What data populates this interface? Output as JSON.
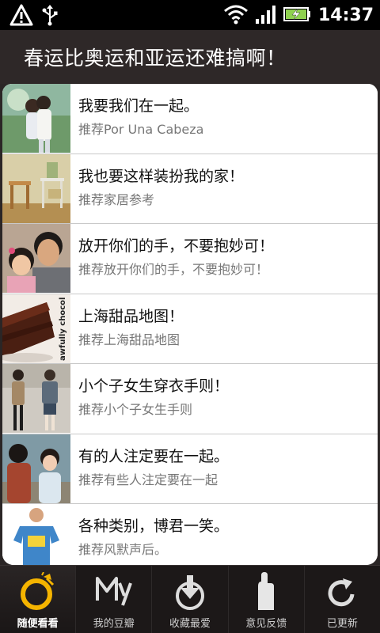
{
  "status_bar": {
    "time": "14:37",
    "icons": [
      "warning-icon",
      "usb-icon",
      "wifi-icon",
      "signal-icon",
      "battery-charging-icon"
    ]
  },
  "header": {
    "title": "春运比奥运和亚运还难搞啊！"
  },
  "list": {
    "items": [
      {
        "title": "我要我们在一起。",
        "subtitle": "推荐Por Una Cabeza",
        "thumb": "couple-photo"
      },
      {
        "title": "我也要这样装扮我的家！",
        "subtitle": "推荐家居参考",
        "thumb": "furniture-photo"
      },
      {
        "title": "放开你们的手，不要抱妙可！",
        "subtitle": "推荐放开你们的手，不要抱妙可！",
        "thumb": "man-and-girl-photo"
      },
      {
        "title": "上海甜品地图！",
        "subtitle": "推荐上海甜品地图",
        "thumb": "chocolate-cake-photo",
        "thumb_text": "awfully chocolate"
      },
      {
        "title": "小个子女生穿衣手则！",
        "subtitle": "推荐小个子女生手则",
        "thumb": "fashion-photo"
      },
      {
        "title": "有的人注定要在一起。",
        "subtitle": "推荐有些人注定要在一起",
        "thumb": "couple-street-photo"
      },
      {
        "title": "各种类别，博君一笑。",
        "subtitle": "推荐风默声后。",
        "thumb": "tshirt-man-photo"
      }
    ]
  },
  "tabs": [
    {
      "label": "随便看看",
      "icon": "random-icon",
      "active": true
    },
    {
      "label": "我的豆瓣",
      "icon": "my-douban-icon",
      "active": false
    },
    {
      "label": "收藏最爱",
      "icon": "download-icon",
      "active": false
    },
    {
      "label": "意见反馈",
      "icon": "feedback-hand-icon",
      "active": false
    },
    {
      "label": "已更新",
      "icon": "refresh-icon",
      "active": false
    }
  ],
  "colors": {
    "accent": "#f5b400",
    "background": "#2b2626",
    "statusbar": "#000000"
  }
}
